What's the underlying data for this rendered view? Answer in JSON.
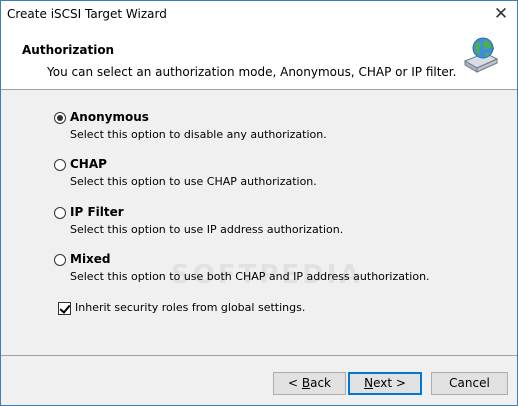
{
  "window": {
    "title": "Create iSCSI Target Wizard",
    "close_glyph": "✕"
  },
  "header": {
    "title": "Authorization",
    "subtitle": "You can select an authorization mode, Anonymous, CHAP or IP filter.",
    "icon": "network-drive-globe-icon"
  },
  "options": [
    {
      "label": "Anonymous",
      "description": "Select this option to disable any authorization.",
      "selected": true
    },
    {
      "label": "CHAP",
      "description": "Select this option to use CHAP authorization.",
      "selected": false
    },
    {
      "label": "IP Filter",
      "description": "Select this option to use IP address authorization.",
      "selected": false
    },
    {
      "label": "Mixed",
      "description": "Select this option to use both CHAP and IP address authorization.",
      "selected": false
    }
  ],
  "inherit": {
    "label": "Inherit security roles from global settings.",
    "checked": true
  },
  "watermark": "SOFTPEDIA",
  "buttons": {
    "back_prefix": "< ",
    "back_mnemonic": "B",
    "back_rest": "ack",
    "next_mnemonic": "N",
    "next_rest": "ext >",
    "cancel": "Cancel"
  }
}
